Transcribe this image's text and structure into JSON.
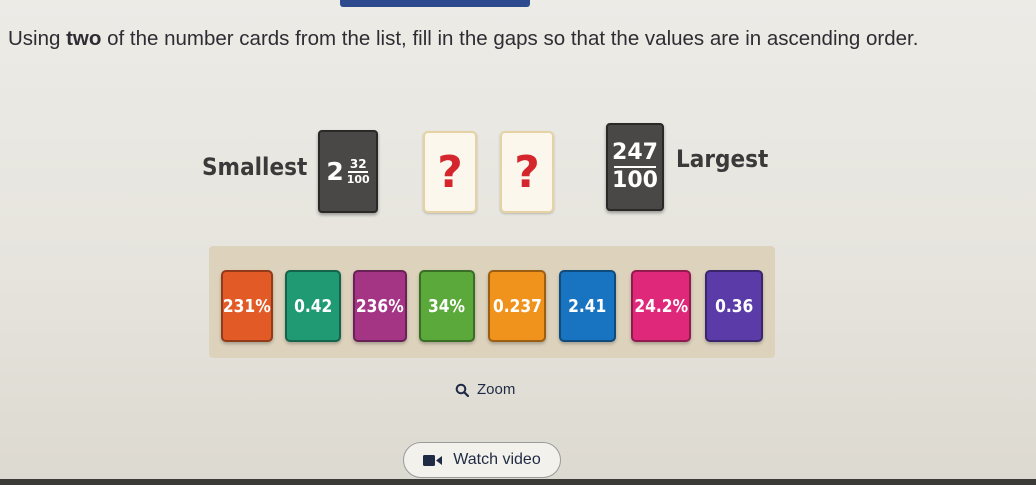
{
  "question": {
    "before": "Using ",
    "emph": "two",
    "after": " of the number cards from the list, fill in the gaps so that the values are in ascending order."
  },
  "order": {
    "smallest_label": "Smallest",
    "largest_label": "Largest",
    "first_card": {
      "whole": "2",
      "numerator": "32",
      "denominator": "100"
    },
    "last_card": {
      "numerator": "247",
      "denominator": "100"
    },
    "gaps": [
      "?",
      "?"
    ]
  },
  "options": [
    {
      "label": "231%",
      "color": "#e25b27"
    },
    {
      "label": "0.42",
      "color": "#1f9a73"
    },
    {
      "label": "236%",
      "color": "#a33584"
    },
    {
      "label": "34%",
      "color": "#5aa93a"
    },
    {
      "label": "0.237",
      "color": "#f0931c"
    },
    {
      "label": "2.41",
      "color": "#1873c0"
    },
    {
      "label": "24.2%",
      "color": "#e0287a"
    },
    {
      "label": "0.36",
      "color": "#5b3ba8"
    }
  ],
  "zoom": {
    "label": "Zoom",
    "icon": "search-icon"
  },
  "watch_video": {
    "label": "Watch video",
    "icon": "video-icon"
  },
  "colors": {
    "accent_blue": "#2e4a8f",
    "gap_question_mark": "#d4262c",
    "dark_card": "#4a4846",
    "tray": "#ddd3bd"
  }
}
